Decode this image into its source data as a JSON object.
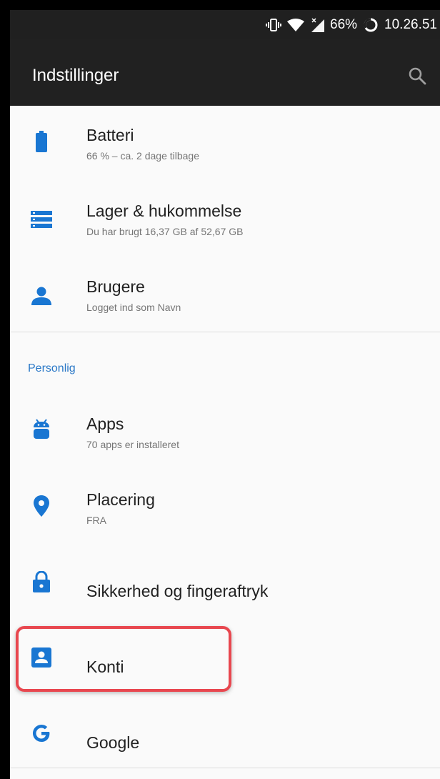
{
  "status_bar": {
    "battery_percent": "66%",
    "time": "10.26.51",
    "icons": [
      "vibrate-icon",
      "wifi-icon",
      "signal-icon",
      "battery-ring-icon"
    ]
  },
  "app_bar": {
    "title": "Indstillinger",
    "search_icon": "search-icon"
  },
  "settings": {
    "device_items": [
      {
        "title": "Batteri",
        "subtitle": "66 % – ca. 2 dage tilbage",
        "icon": "battery-icon"
      },
      {
        "title": "Lager & hukommelse",
        "subtitle": "Du har brugt 16,37 GB af 52,67 GB",
        "icon": "storage-icon"
      },
      {
        "title": "Brugere",
        "subtitle": "Logget ind som Navn",
        "icon": "user-icon"
      }
    ],
    "personal_header": "Personlig",
    "personal_items": [
      {
        "title": "Apps",
        "subtitle": "70 apps er installeret",
        "icon": "android-icon"
      },
      {
        "title": "Placering",
        "subtitle": "FRA",
        "icon": "location-pin-icon"
      },
      {
        "title": "Sikkerhed og fingeraftryk",
        "icon": "lock-icon"
      },
      {
        "title": "Konti",
        "icon": "account-box-icon",
        "highlighted": true
      },
      {
        "title": "Google",
        "icon": "google-icon"
      }
    ]
  },
  "colors": {
    "accent": "#2a78c7",
    "icon": "#1976d2",
    "highlight_border": "#e8474f",
    "app_bar": "#212121",
    "background": "#fafafa"
  }
}
